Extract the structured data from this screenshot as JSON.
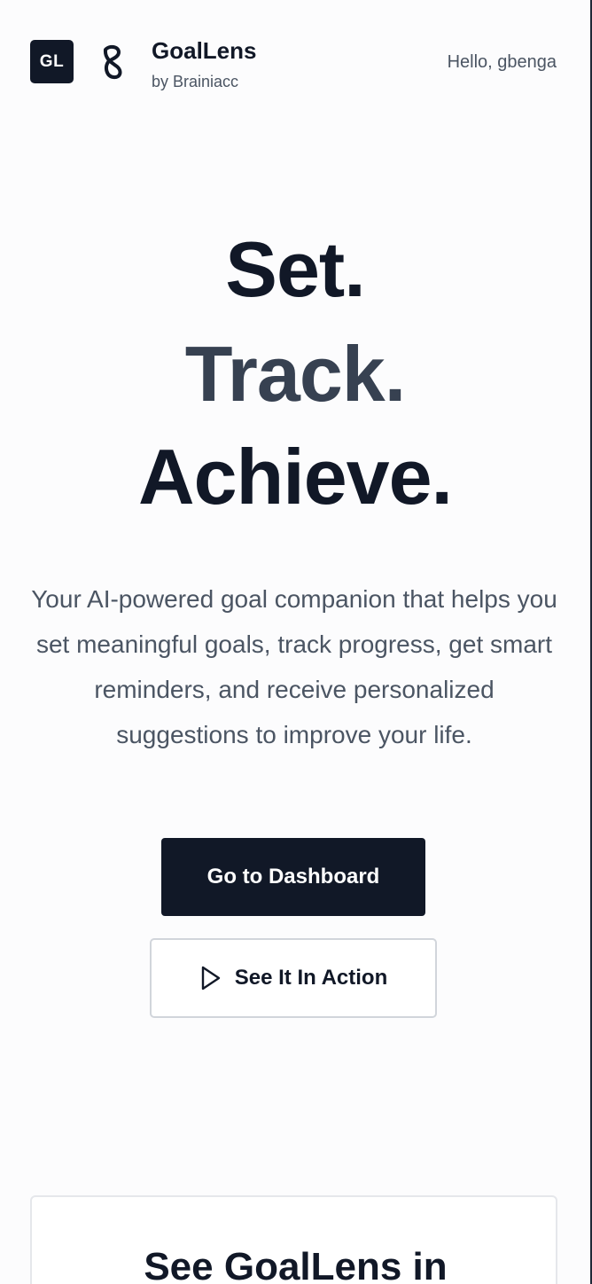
{
  "header": {
    "logo_initials": "GL",
    "brand_name": "GoalLens",
    "brand_sub": "by Brainiacc",
    "greeting": "Hello, gbenga"
  },
  "hero": {
    "line1": "Set.",
    "line2": "Track.",
    "line3": "Achieve.",
    "description": "Your AI-powered goal companion that helps you set meaningful goals, track progress, get smart reminders, and receive personalized suggestions to improve your life."
  },
  "actions": {
    "dashboard_label": "Go to Dashboard",
    "demo_label": "See It In Action"
  },
  "demo_section": {
    "title": "See GoalLens in"
  },
  "icons": {
    "brand_mark": "brainiacc-logo-icon",
    "play": "play-icon"
  },
  "colors": {
    "primary": "#111827",
    "secondary_text": "#4b5563",
    "track_line": "#374151",
    "border": "#d1d5db",
    "background": "#fcfcfd"
  }
}
